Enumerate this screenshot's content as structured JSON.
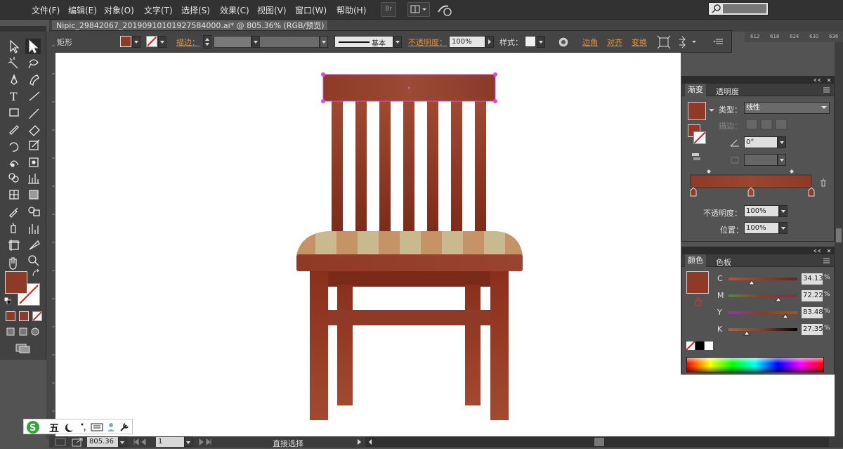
{
  "menu": [
    "文件(F)",
    "编辑(E)",
    "对象(O)",
    "文字(T)",
    "选择(S)",
    "效果(C)",
    "视图(V)",
    "窗口(W)",
    "帮助(H)"
  ],
  "menu_extra": {
    "br_label": "Br"
  },
  "document_tab": "Nipic_29842067_20190910101927584000.ai* @ 805.36% (RGB/预览)",
  "ruler_ticks": [
    "612",
    "618",
    "624",
    "630",
    "636"
  ],
  "control_bar": {
    "object_type": "矩形",
    "stroke_label": "描边：",
    "stroke_profile": "基本",
    "opacity_label": "不透明度：",
    "opacity_value": "100%",
    "style_label": "样式：",
    "corner_label": "边角",
    "align_label": "对齐",
    "transform_label": "变换"
  },
  "gradient_panel": {
    "tab_gradient": "渐变",
    "tab_transparency": "透明度",
    "type_label": "类型：",
    "type_value": "线性",
    "stroke_label": "描边：",
    "angle_value": "0°",
    "opacity_label": "不透明度：",
    "opacity_value": "100%",
    "location_label": "位置：",
    "location_value": "100%"
  },
  "color_panel": {
    "tab_color": "颜色",
    "tab_swatches": "色板",
    "channels": [
      {
        "label": "C",
        "value": "34.13",
        "fraction": 0.34
      },
      {
        "label": "M",
        "value": "72.22",
        "fraction": 0.72
      },
      {
        "label": "Y",
        "value": "83.48",
        "fraction": 0.83
      },
      {
        "label": "K",
        "value": "27.35",
        "fraction": 0.27
      }
    ],
    "percent_sign": "%"
  },
  "status_bar": {
    "zoom": "805.36",
    "page": "1",
    "tool_name": "直接选择"
  },
  "ime": {
    "mode": "五"
  },
  "colors": {
    "fill": "#8e3a27",
    "accent_orange": "#e8903a",
    "selection": "#d84de0"
  }
}
